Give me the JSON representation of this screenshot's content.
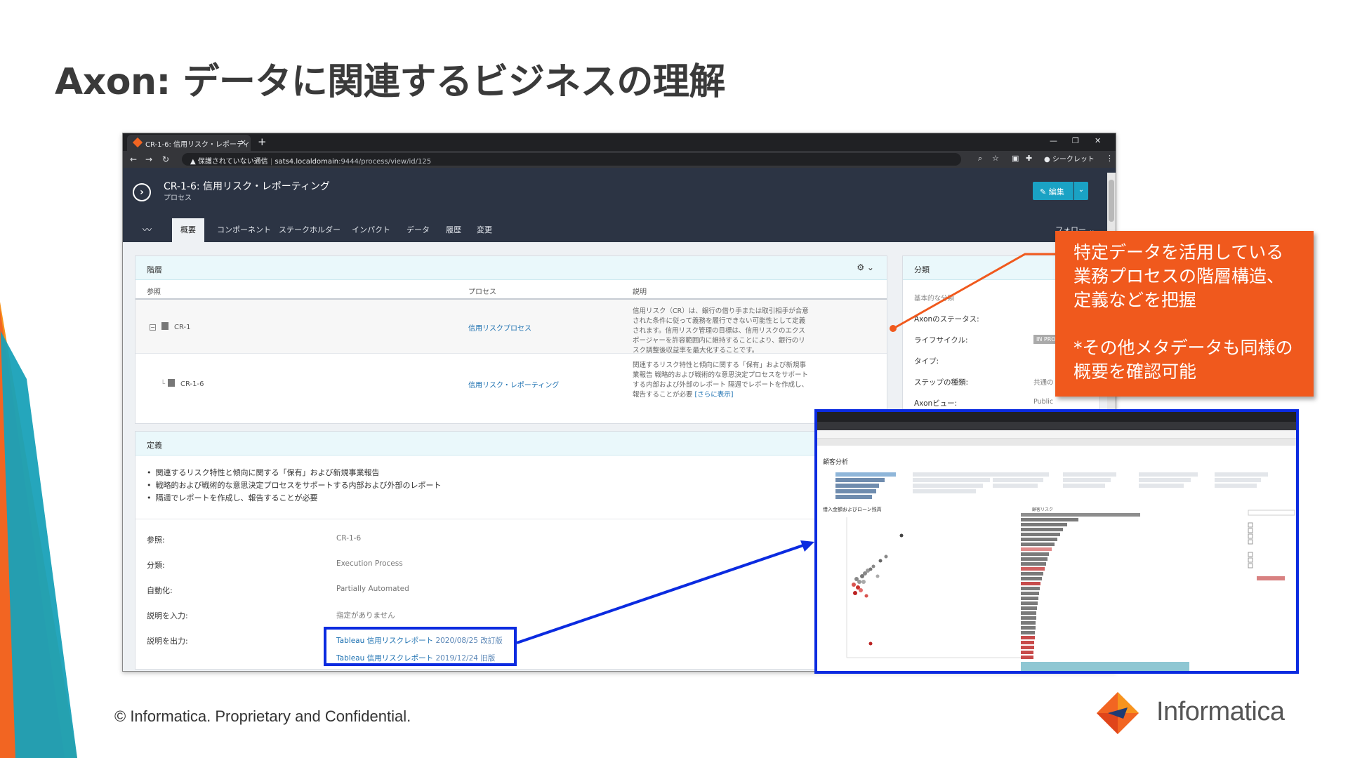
{
  "slide": {
    "title": "Axon: データに関連するビジネスの理解",
    "footer": "© Informatica. Proprietary and Confidential.",
    "logo_text": "Informatica"
  },
  "browser": {
    "tab_title": "CR-1-6: 信用リスク・レポーティング",
    "tab_close": "×",
    "new_tab": "+",
    "window_controls": [
      "—",
      "❐",
      "✕"
    ],
    "url_warning": "保護されていない通信",
    "url_host": "sats4.localdomain",
    "url_path": ":9444/process/view/id/125",
    "incognito": "シークレット"
  },
  "app": {
    "process_title": "CR-1-6: 信用リスク・レポーティング",
    "process_type": "プロセス",
    "edit_button": "編集",
    "tabs": [
      "概要",
      "コンポーネント",
      "ステークホルダー",
      "インパクト",
      "データ",
      "履歴",
      "変更"
    ],
    "follow": "フォロー"
  },
  "hierarchy": {
    "title": "階層",
    "columns": [
      "参照",
      "プロセス",
      "説明"
    ],
    "rows": [
      {
        "ref": "CR-1",
        "process": "信用リスクプロセス",
        "description": "信用リスク（CR）は、銀行の借り手または取引相手が合意された条件に従って義務を履行できない可能性として定義されます。信用リスク管理の目標は、信用リスクのエクスポージャーを許容範囲内に維持することにより、銀行のリスク調整後収益率を最大化することです。"
      },
      {
        "ref": "CR-1-6",
        "process": "信用リスク・レポーティング",
        "description": "関連するリスク特性と傾向に関する「保有」および新規事業報告 戦略的および戦術的な意思決定プロセスをサポートする内部および外部のレポート 隔週でレポートを作成し、報告することが必要",
        "more": "[さらに表示]"
      }
    ]
  },
  "definition": {
    "title": "定義",
    "bullets": [
      "関連するリスク特性と傾向に関する「保有」および新規事業報告",
      "戦略的および戦術的な意思決定プロセスをサポートする内部および外部のレポート",
      "隔週でレポートを作成し、報告することが必要"
    ],
    "fields": [
      {
        "label": "参照:",
        "value": "CR-1-6"
      },
      {
        "label": "分類:",
        "value": "Execution Process"
      },
      {
        "label": "自動化:",
        "value": "Partially Automated"
      },
      {
        "label": "説明を入力:",
        "value": "指定がありません"
      }
    ],
    "output_label": "説明を出力:",
    "outputs": [
      {
        "name": "Tableau 信用リスクレポート",
        "version": "2020/08/25 改訂版"
      },
      {
        "name": "Tableau 信用リスクレポート",
        "version": "2019/12/24 旧版"
      }
    ]
  },
  "classification": {
    "title": "分類",
    "subtitle": "基本的な分類",
    "fields": [
      {
        "label": "Axonのステータス:",
        "value": ""
      },
      {
        "label": "ライフサイクル:",
        "value": "IN PRO"
      },
      {
        "label": "タイプ:",
        "value": ""
      },
      {
        "label": "ステップの種類:",
        "value": "共通の"
      },
      {
        "label": "Axonビュー:",
        "value": "Public"
      }
    ]
  },
  "callout": {
    "lines": [
      "特定データを活用している",
      "業務プロセスの階層構造、",
      "定義などを把握",
      "",
      "*その他メタデータも同様の",
      "概要を確認可能"
    ]
  },
  "tableau": {
    "title": "顧客分析",
    "subtitle": "借入金額およびローン残高",
    "subtitle2": "顧客リスク"
  },
  "colors": {
    "accent_orange": "#f0591d",
    "highlight_blue": "#0b2be0",
    "app_header": "#2c3444",
    "link": "#1a6fb0"
  }
}
